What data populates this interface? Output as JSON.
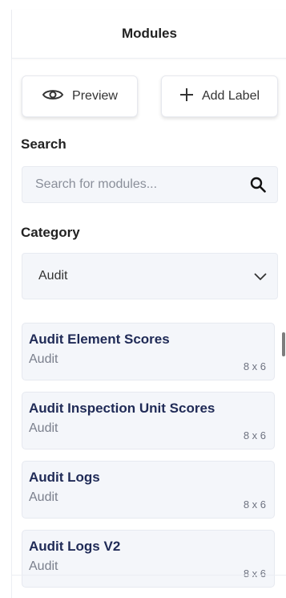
{
  "panel": {
    "title": "Modules"
  },
  "toolbar": {
    "preview_label": "Preview",
    "add_label": "Add Label"
  },
  "search": {
    "label": "Search",
    "placeholder": "Search for modules...",
    "value": ""
  },
  "category": {
    "label": "Category",
    "selected": "Audit"
  },
  "modules": [
    {
      "name": "Audit Element Scores",
      "category": "Audit",
      "size": "8 x 6"
    },
    {
      "name": "Audit Inspection Unit Scores",
      "category": "Audit",
      "size": "8 x 6"
    },
    {
      "name": "Audit Logs",
      "category": "Audit",
      "size": "8 x 6"
    },
    {
      "name": "Audit Logs V2",
      "category": "Audit",
      "size": "8 x 6"
    }
  ],
  "icons": {
    "preview": "eye-icon",
    "add": "plus-icon",
    "search": "search-icon",
    "dropdown": "chevron-down-icon"
  },
  "colors": {
    "module_title": "#1f2a56",
    "field_background": "#f4f6fa"
  }
}
